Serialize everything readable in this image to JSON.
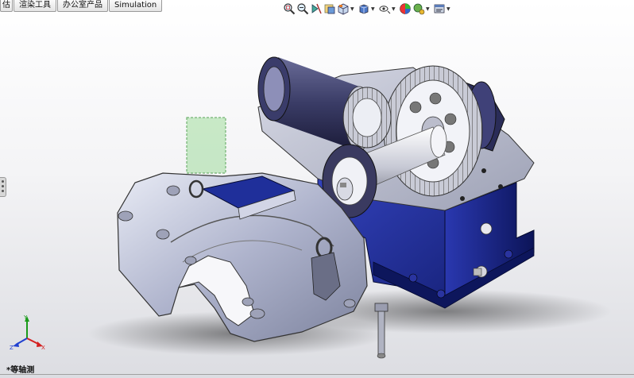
{
  "tabs": [
    "估",
    "渲染工具",
    "办公室产品",
    "Simulation"
  ],
  "toolbar": {
    "icons": [
      "zoom-to-fit-icon",
      "zoom-area-icon",
      "previous-view-icon",
      "section-view-icon",
      "view-orientation-icon",
      "display-style-icon",
      "hide-show-icon",
      "appearance-icon",
      "scene-icon",
      "view-settings-icon"
    ]
  },
  "view": {
    "label": "*等轴测"
  },
  "triad": {
    "x": "X",
    "y": "Y",
    "z": "Z"
  },
  "colors": {
    "housing": "#1f2f9a",
    "cover": "#c4c8dc",
    "bg_top": "#ffffff",
    "bg_bottom": "#dcdde2"
  }
}
